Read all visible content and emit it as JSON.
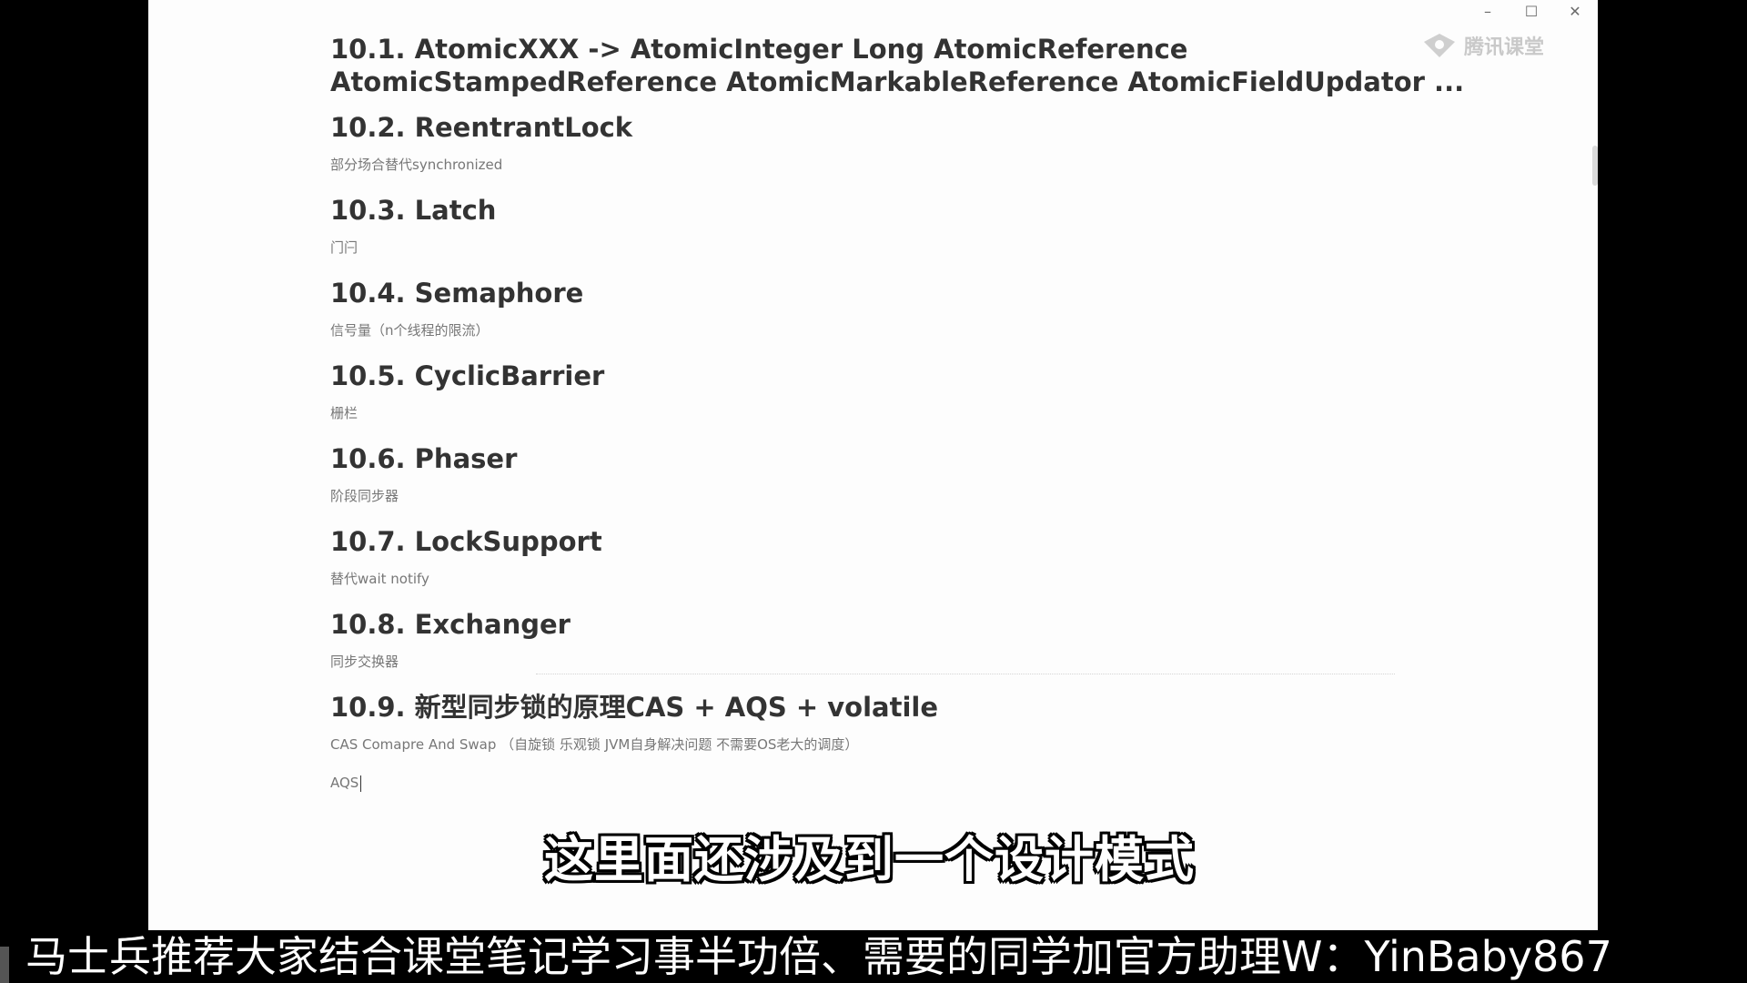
{
  "window": {
    "controls": {
      "minimize": "–",
      "maximize": "☐",
      "close": "✕"
    },
    "watermark_text": "腾讯课堂"
  },
  "sections": [
    {
      "heading": "10.1. AtomicXXX -> AtomicInteger Long AtomicReference AtomicStampedReference AtomicMarkableReference AtomicFieldUpdator ...",
      "desc": ""
    },
    {
      "heading": "10.2. ReentrantLock",
      "desc": "部分场合替代synchronized"
    },
    {
      "heading": "10.3. Latch",
      "desc": "门闩"
    },
    {
      "heading": "10.4. Semaphore",
      "desc": "信号量（n个线程的限流）"
    },
    {
      "heading": "10.5. CyclicBarrier",
      "desc": "栅栏"
    },
    {
      "heading": "10.6. Phaser",
      "desc": "阶段同步器"
    },
    {
      "heading": "10.7. LockSupport",
      "desc": "替代wait notify"
    },
    {
      "heading": "10.8. Exchanger",
      "desc": "同步交换器"
    },
    {
      "heading": "10.9. 新型同步锁的原理CAS + AQS + volatile",
      "desc": "CAS Comapre And Swap （自旋锁 乐观锁 JVM自身解决问题 不需要OS老大的调度）",
      "desc2": "AQS"
    }
  ],
  "subtitle": "这里面还涉及到一个设计模式",
  "banner": "马士兵推荐大家结合课堂笔记学习事半功倍、需要的同学加官方助理W：YinBaby867"
}
